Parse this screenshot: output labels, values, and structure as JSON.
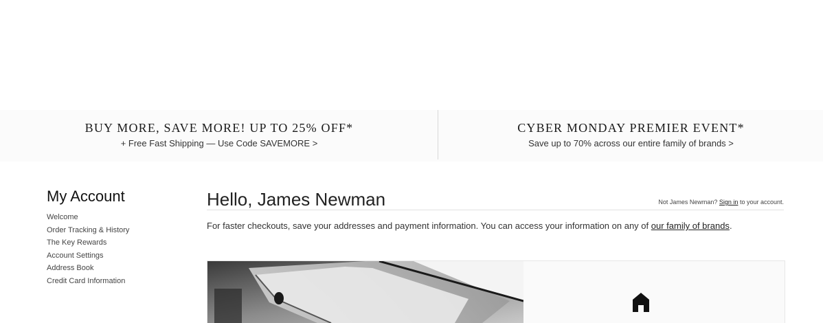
{
  "promos": [
    {
      "title": "BUY MORE, SAVE MORE! UP TO 25% OFF*",
      "subtitle": "+ Free Fast Shipping — Use Code SAVEMORE >"
    },
    {
      "title": "CYBER MONDAY PREMIER EVENT*",
      "subtitle": "Save up to 70% across our entire family of brands >"
    }
  ],
  "sidebar": {
    "title": "My Account",
    "items": [
      {
        "label": "Welcome"
      },
      {
        "label": "Order Tracking & History"
      },
      {
        "label": "The Key Rewards"
      },
      {
        "label": "Account Settings"
      },
      {
        "label": "Address Book"
      },
      {
        "label": "Credit Card Information"
      }
    ]
  },
  "main": {
    "greeting": "Hello, James Newman",
    "not_user_prefix": "Not James Newman?",
    "sign_in_link": "Sign in",
    "not_user_suffix": "to your account.",
    "intro_text": "For faster checkouts, save your addresses and payment information. You can access your information on any of",
    "brands_link": "our family of brands",
    "intro_end": "."
  },
  "hero": {
    "icon": "home-icon"
  }
}
